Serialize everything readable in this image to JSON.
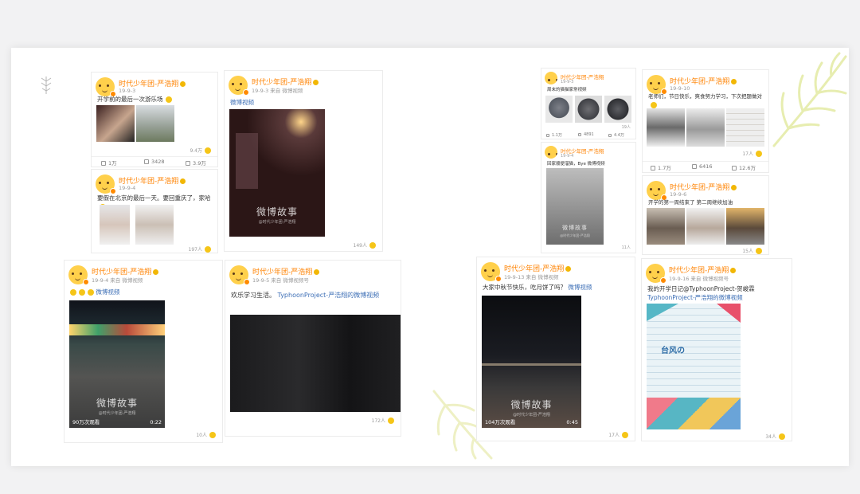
{
  "posts": [
    {
      "user": "时代少年团-严浩翔",
      "meta": "19-9-3",
      "text": "开学前的最后一次游乐场",
      "actions": {
        "repost": "1万",
        "comment": "3428",
        "like": "3.9万"
      },
      "likes": "9.4万"
    },
    {
      "user": "时代少年团-严浩翔",
      "meta": "19-9-3 来自 微博视频",
      "text": "微博视频",
      "watermark": "微博故事",
      "watermark_sub": "@时代少年团-严浩翔",
      "likes": "149人"
    },
    {
      "user": "时代少年团-严浩翔",
      "meta": "19-9-4",
      "text": "要假在北京的最后一天。要回重庆了，家哈",
      "likes": "197人"
    },
    {
      "user": "时代少年团-严浩翔",
      "meta": "19-9-3",
      "text": "周末的猫猫家常视频",
      "actions": {
        "repost": "1.1万",
        "comment": "4891",
        "like": "4.4万"
      },
      "likes": "19人"
    },
    {
      "user": "时代少年团-严浩翔",
      "meta": "19-9-10",
      "text": "老师们，节日快乐，爽食努力学习，下次把题做对",
      "actions": {
        "repost": "1.7万",
        "comment": "6416",
        "like": "12.6万"
      },
      "likes": "17人"
    },
    {
      "user": "时代少年团-严浩翔",
      "meta": "19-9-4",
      "text": "回家顺便溜猫，Bye 微博视频",
      "watermark": "微博故事",
      "watermark_sub": "@时代少年团-严浩翔",
      "likes": "11人"
    },
    {
      "user": "时代少年团-严浩翔",
      "meta": "19-9-6",
      "text": "开学的第一周结束了 第二周继续加油",
      "likes": "15人"
    },
    {
      "user": "时代少年团-严浩翔",
      "meta": "19-9-4 来自 微博视频",
      "text": "微博视频",
      "watermark": "微博故事",
      "watermark_sub": "@时代少年团-严浩翔",
      "views": "90万次观看",
      "duration": "0:22",
      "likes": "10人"
    },
    {
      "user": "时代少年团-严浩翔",
      "meta": "19-9-5 来自 微博视频号",
      "text": "欢乐学习生活。",
      "link": "TyphoonProject-严浩翔的微博视频",
      "likes": "172人"
    },
    {
      "user": "时代少年团-严浩翔",
      "meta": "19-9-13 来自 微博视频",
      "text": "大家中秋节快乐，吃月饼了吗？",
      "link": "微博视频",
      "watermark": "微博故事",
      "watermark_sub": "@时代少年团-严浩翔",
      "views": "104万次观看",
      "duration": "0:45",
      "likes": "17人"
    },
    {
      "user": "时代少年团-严浩翔",
      "meta": "19-9-16 来自 微博视频号",
      "text": "我的开学日记@TyphoonProject-贺峻霖",
      "link": "TyphoonProject-严浩翔的微博视频",
      "cover_text": "台风の",
      "likes": "34人"
    }
  ],
  "colors": {
    "accent": "#ff8200",
    "link": "#3d6fb6"
  },
  "icons": [
    "avatar-icon",
    "vip-badge-icon",
    "repost-icon",
    "comment-icon",
    "like-icon",
    "play-icon",
    "leaf-decoration-icon"
  ]
}
